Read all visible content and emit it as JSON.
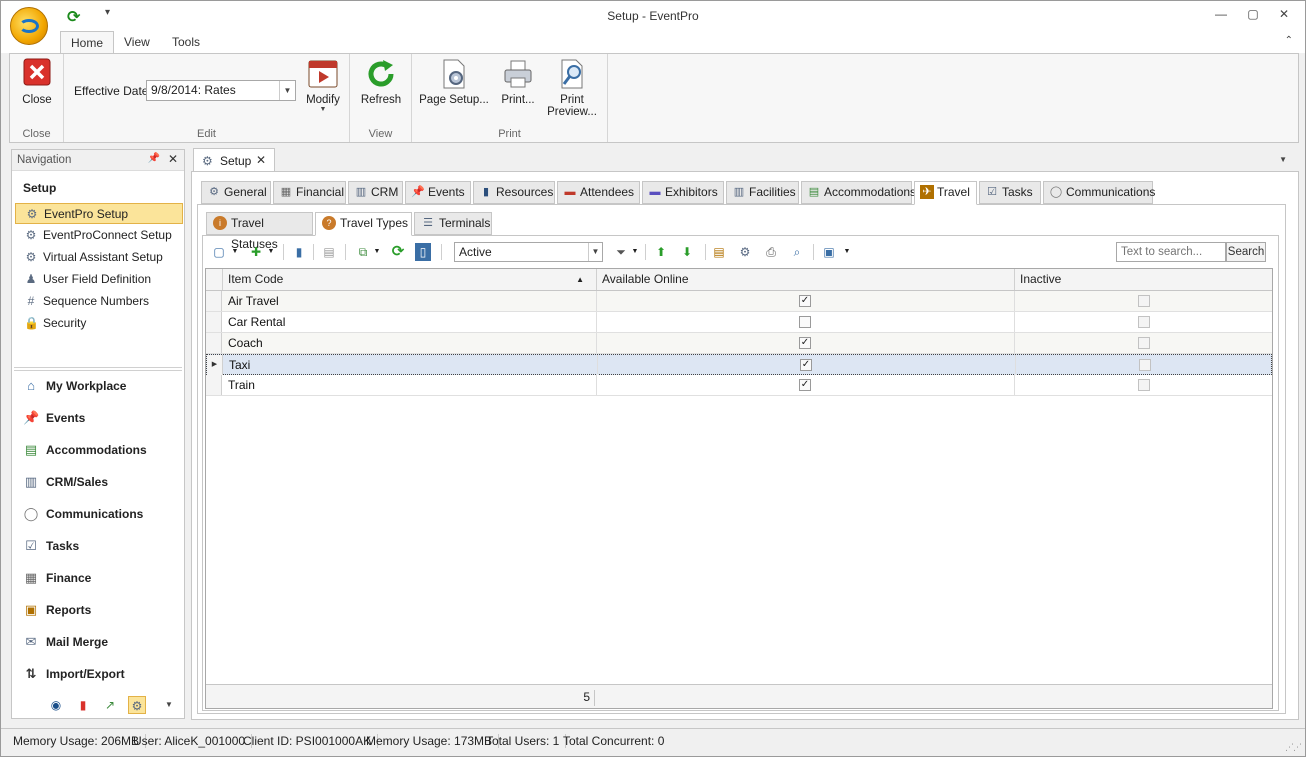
{
  "window": {
    "title": "Setup - EventPro",
    "min": "—",
    "max": "▢",
    "close": "✕"
  },
  "qat": {
    "refresh": "⟳",
    "more": "▾"
  },
  "ribbon": {
    "tabs": [
      "Home",
      "View",
      "Tools"
    ],
    "collapse": "⌃",
    "groups": {
      "close": {
        "label": "Close",
        "button": "Close"
      },
      "edit": {
        "label": "Edit",
        "effective_date_label": "Effective Date",
        "effective_date_value": "9/8/2014: Rates",
        "modify": "Modify"
      },
      "view": {
        "label": "View",
        "refresh": "Refresh"
      },
      "print": {
        "label": "Print",
        "page_setup": "Page Setup...",
        "print": "Print...",
        "print_preview_1": "Print",
        "print_preview_2": "Preview..."
      }
    }
  },
  "nav": {
    "header": "Navigation",
    "title": "Setup",
    "items": [
      {
        "label": "EventPro Setup",
        "icon": "gear-icon"
      },
      {
        "label": "EventProConnect Setup",
        "icon": "gear-icon"
      },
      {
        "label": "Virtual Assistant Setup",
        "icon": "gear-icon"
      },
      {
        "label": "User Field Definition",
        "icon": "user-icon"
      },
      {
        "label": "Sequence Numbers",
        "icon": "hash-icon"
      },
      {
        "label": "Security",
        "icon": "lock-icon"
      }
    ],
    "modules": [
      {
        "label": "My Workplace",
        "icon": "home-icon"
      },
      {
        "label": "Events",
        "icon": "pin-icon"
      },
      {
        "label": "Accommodations",
        "icon": "bed-icon"
      },
      {
        "label": "CRM/Sales",
        "icon": "building-icon"
      },
      {
        "label": "Communications",
        "icon": "speech-icon"
      },
      {
        "label": "Tasks",
        "icon": "clipboard-icon"
      },
      {
        "label": "Finance",
        "icon": "calculator-icon"
      },
      {
        "label": "Reports",
        "icon": "report-icon"
      },
      {
        "label": "Mail Merge",
        "icon": "mail-merge-icon"
      },
      {
        "label": "Import/Export",
        "icon": "import-export-icon"
      }
    ]
  },
  "document": {
    "tab": "Setup",
    "setup_tabs": [
      "General",
      "Financial",
      "CRM",
      "Events",
      "Resources",
      "Attendees",
      "Exhibitors",
      "Facilities",
      "Accommodations",
      "Travel",
      "Tasks",
      "Communications"
    ],
    "travel_tabs": [
      "Travel Statuses",
      "Travel Types",
      "Terminals"
    ]
  },
  "toolbar": {
    "filter_value": "Active",
    "search_placeholder": "Text to search...",
    "search_button": "Search"
  },
  "grid": {
    "columns": [
      "Item Code",
      "Available Online",
      "Inactive"
    ],
    "sort_indicator": "▲",
    "rows": [
      {
        "item_code": "Air Travel",
        "available_online": true,
        "inactive": false
      },
      {
        "item_code": "Car Rental",
        "available_online": false,
        "inactive": false
      },
      {
        "item_code": "Coach",
        "available_online": true,
        "inactive": false
      },
      {
        "item_code": "Taxi",
        "available_online": true,
        "inactive": false
      },
      {
        "item_code": "Train",
        "available_online": true,
        "inactive": false
      }
    ],
    "count": "5"
  },
  "status": {
    "memory": "Memory Usage: 206MB",
    "user": "User: AliceK_001000",
    "client": "Client ID: PSI001000AK",
    "memory2": "Memory Usage: 173MB",
    "total_users": "Total Users: 1",
    "total_concurrent": "Total Concurrent: 0"
  },
  "colors": {
    "selected_nav": "#fbe49a",
    "focused_row": "#dde6f3",
    "refresh_green": "#1b8a1b",
    "close_red": "#d9312b"
  }
}
